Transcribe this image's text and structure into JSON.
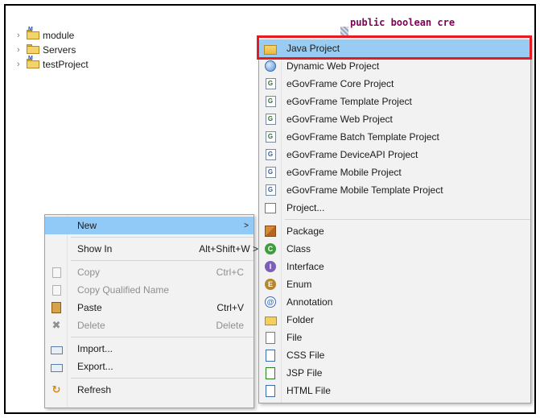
{
  "tree": {
    "items": [
      {
        "label": "module",
        "icon": "maven-project-icon"
      },
      {
        "label": "Servers",
        "icon": "folder-icon"
      },
      {
        "label": "testProject",
        "icon": "maven-project-icon"
      }
    ]
  },
  "editor": {
    "line_text": "public boolean cre"
  },
  "context_menu": {
    "items": [
      {
        "label": "New",
        "shortcut": "",
        "icon": ""
      },
      {
        "label": "Show In",
        "shortcut": "Alt+Shift+W >",
        "icon": ""
      },
      {
        "label": "Copy",
        "shortcut": "Ctrl+C",
        "icon": "copy-icon"
      },
      {
        "label": "Copy Qualified Name",
        "shortcut": "",
        "icon": "copy-qualified-name-icon"
      },
      {
        "label": "Paste",
        "shortcut": "Ctrl+V",
        "icon": "paste-icon"
      },
      {
        "label": "Delete",
        "shortcut": "Delete",
        "icon": "delete-icon"
      },
      {
        "label": "Import...",
        "shortcut": "",
        "icon": "import-icon"
      },
      {
        "label": "Export...",
        "shortcut": "",
        "icon": "export-icon"
      },
      {
        "label": "Refresh",
        "shortcut": "",
        "icon": "refresh-icon"
      }
    ],
    "new_arrow": ">"
  },
  "new_submenu": {
    "items": [
      {
        "label": "Java Project",
        "icon": "java-project-icon"
      },
      {
        "label": "Dynamic Web Project",
        "icon": "dynamic-web-project-icon"
      },
      {
        "label": "eGovFrame Core Project",
        "icon": "egovframe-core-icon"
      },
      {
        "label": "eGovFrame Template Project",
        "icon": "egovframe-template-icon"
      },
      {
        "label": "eGovFrame Web Project",
        "icon": "egovframe-web-icon"
      },
      {
        "label": "eGovFrame Batch Template Project",
        "icon": "egovframe-batch-icon"
      },
      {
        "label": "eGovFrame DeviceAPI Project",
        "icon": "egovframe-deviceapi-icon"
      },
      {
        "label": "eGovFrame Mobile Project",
        "icon": "egovframe-mobile-icon"
      },
      {
        "label": "eGovFrame Mobile Template Project",
        "icon": "egovframe-mobile-template-icon"
      },
      {
        "label": "Project...",
        "icon": "project-icon"
      },
      {
        "label": "Package",
        "icon": "package-icon"
      },
      {
        "label": "Class",
        "icon": "class-icon"
      },
      {
        "label": "Interface",
        "icon": "interface-icon"
      },
      {
        "label": "Enum",
        "icon": "enum-icon"
      },
      {
        "label": "Annotation",
        "icon": "annotation-icon"
      },
      {
        "label": "Folder",
        "icon": "folder-icon"
      },
      {
        "label": "File",
        "icon": "file-icon"
      },
      {
        "label": "CSS File",
        "icon": "css-file-icon"
      },
      {
        "label": "JSP File",
        "icon": "jsp-file-icon"
      },
      {
        "label": "HTML File",
        "icon": "html-file-icon"
      }
    ]
  },
  "colors": {
    "highlight": "#99ccf3",
    "callout": "#e31b23"
  }
}
